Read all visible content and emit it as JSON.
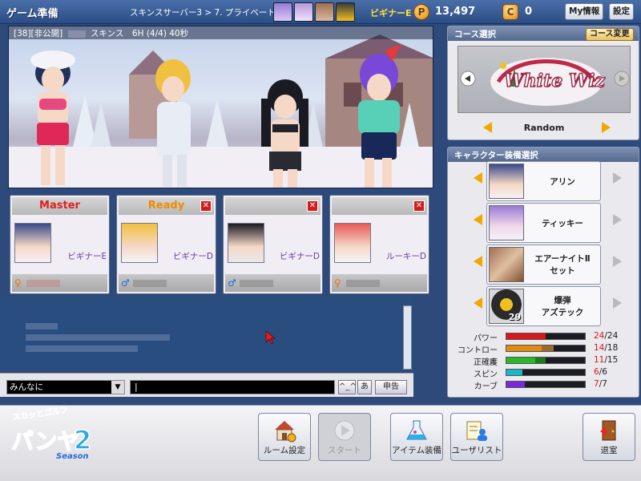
{
  "topbar": {
    "title": "ゲーム準備",
    "server": "スキンスサーバー3 > 7. プライベート",
    "username": "ビギナーE",
    "points": "13,497",
    "cookies": "0",
    "myinfo_label": "My情報",
    "settings_label": "設定"
  },
  "room": {
    "info_prefix": "[38][非公開]",
    "info_suffix": "スキンス　6H (4/4) 40秒"
  },
  "players": [
    {
      "status": "Master",
      "name": "ビギナーE",
      "gender": "f"
    },
    {
      "status": "Ready",
      "name": "ビギナーD",
      "gender": "m"
    },
    {
      "status": "",
      "name": "ビギナーD",
      "gender": "m"
    },
    {
      "status": "",
      "name": "ルーキーD",
      "gender": "f"
    }
  ],
  "chat": {
    "target": "みんなに",
    "input_value": "",
    "caret_btn": "^_^",
    "kana_btn": "あ",
    "report_btn": "申告"
  },
  "course": {
    "header": "コース選択",
    "change_btn": "コース変更",
    "logo": "White Wiz",
    "mode": "Random"
  },
  "equipment": {
    "header": "キャラクター装備選択",
    "items": [
      {
        "label1": "アリン",
        "label2": ""
      },
      {
        "label1": "ティッキー",
        "label2": ""
      },
      {
        "label1": "エアーナイトⅡ",
        "label2": "セット"
      },
      {
        "label1": "爆弾",
        "label2": "アズテック",
        "count": "29"
      }
    ]
  },
  "stats": [
    {
      "label": "パワー",
      "cur": "24",
      "max": "24",
      "color": "#d81818",
      "color2": "#d81818",
      "ratio": 0.5,
      "ratio2": 0.5
    },
    {
      "label": "コントロール",
      "cur": "14",
      "max": "18",
      "color": "#e08a10",
      "color2": "#9a6a30",
      "ratio": 0.45,
      "ratio2": 0.6
    },
    {
      "label": "正確度",
      "cur": "11",
      "max": "15",
      "color": "#28b828",
      "color2": "#1c7a1c",
      "ratio": 0.37,
      "ratio2": 0.5
    },
    {
      "label": "スピン",
      "cur": "6",
      "max": "6",
      "color": "#18b8c8",
      "color2": "#18b8c8",
      "ratio": 0.2,
      "ratio2": 0.2
    },
    {
      "label": "カーブ",
      "cur": "7",
      "max": "7",
      "color": "#7a28d8",
      "color2": "#7a28d8",
      "ratio": 0.23,
      "ratio2": 0.23
    }
  ],
  "bottom": {
    "room_settings": "ルーム設定",
    "start": "スタート",
    "item_equip": "アイテム装備",
    "user_list": "ユーザリスト",
    "exit": "退室"
  },
  "logo": {
    "line1": "スカッとゴルフ",
    "line2": "パンヤ",
    "number": "2",
    "season": "Season"
  },
  "sep": "/"
}
